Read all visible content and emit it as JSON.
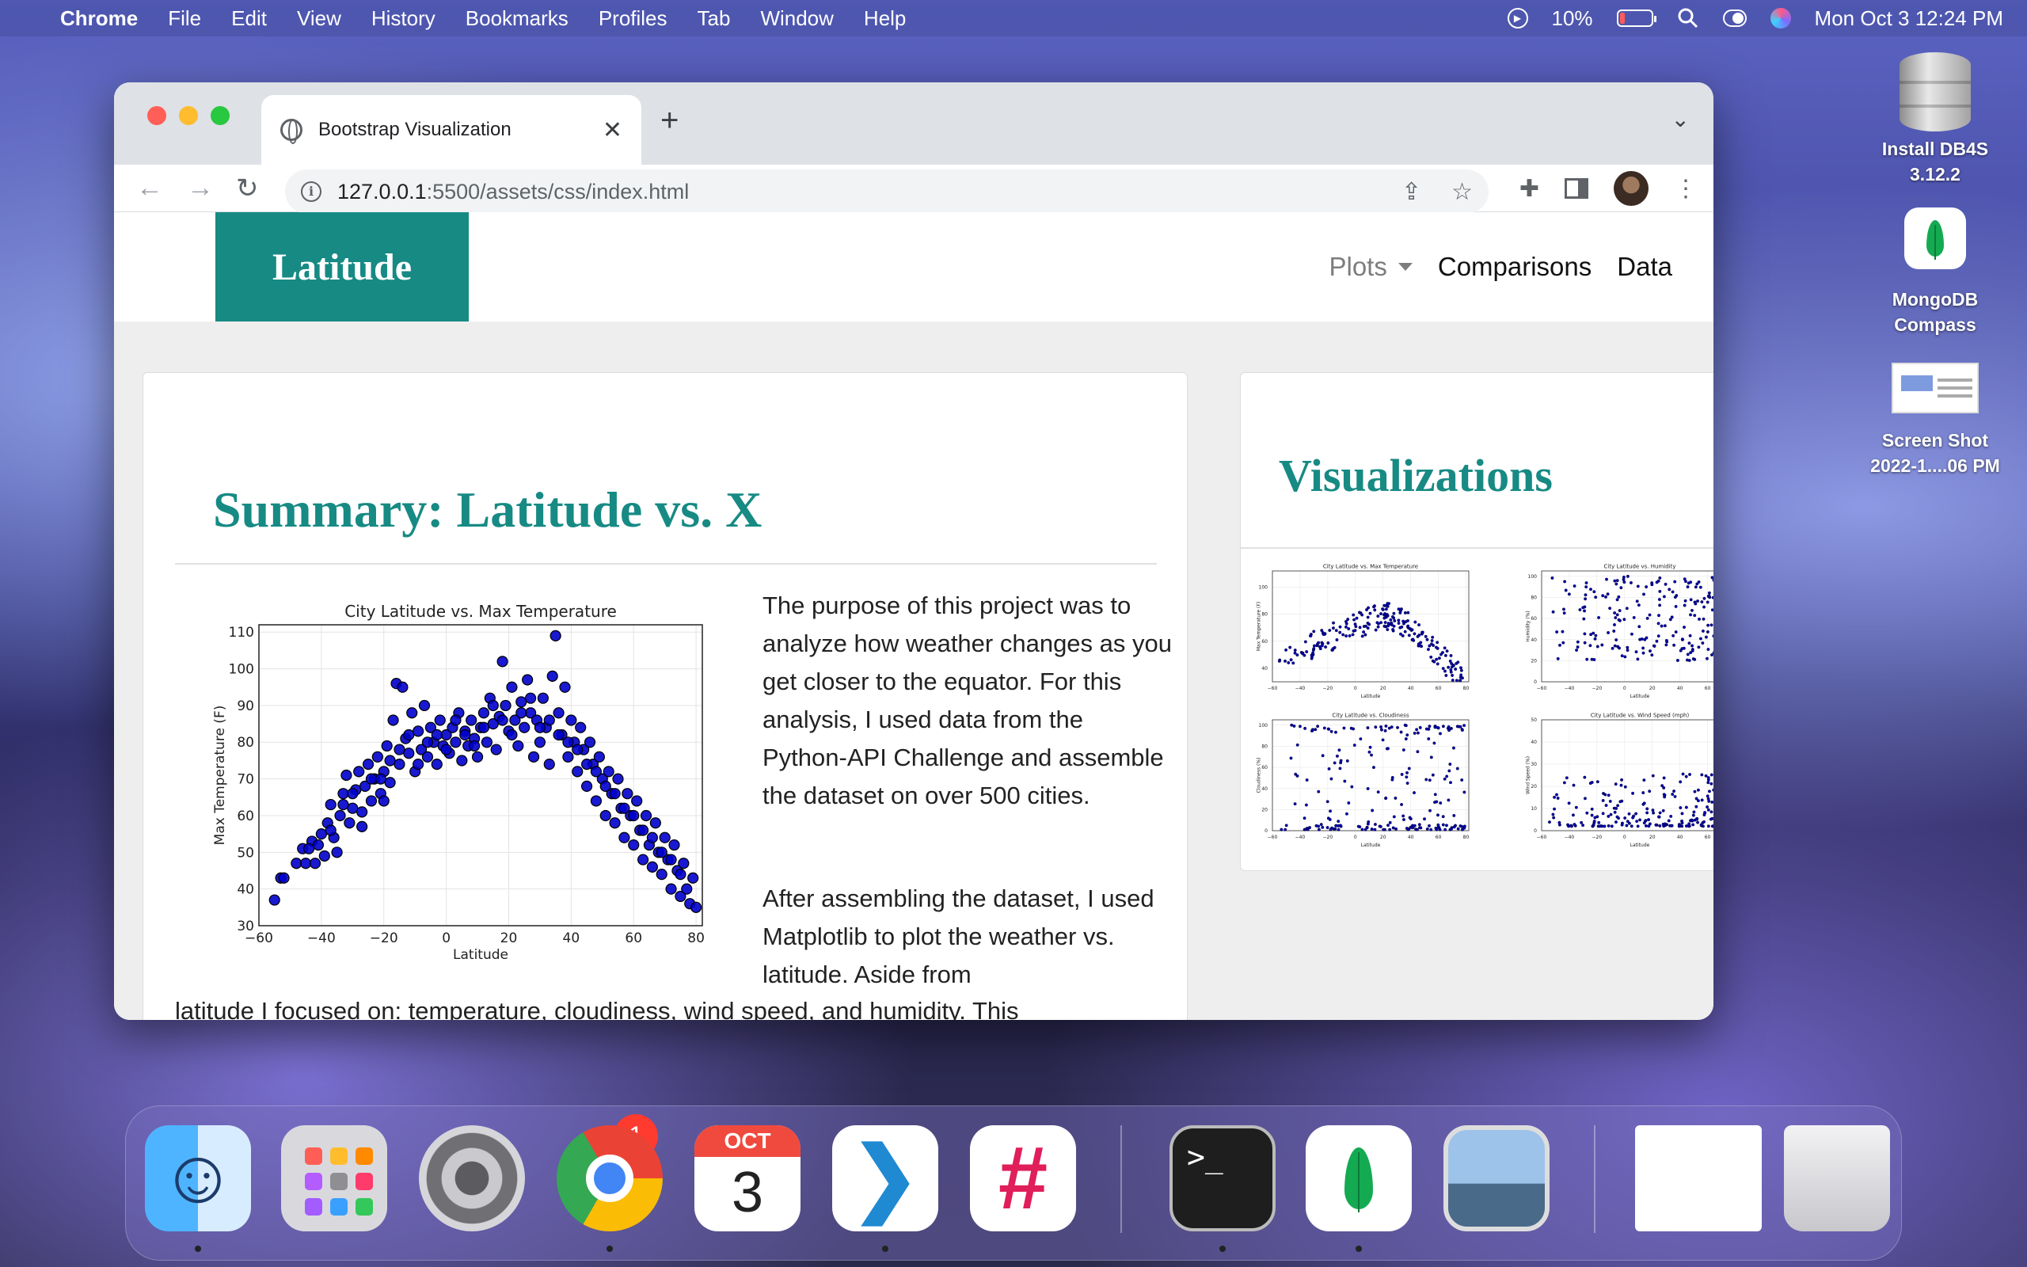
{
  "menubar": {
    "app_name": "Chrome",
    "menus": [
      "File",
      "Edit",
      "View",
      "History",
      "Bookmarks",
      "Profiles",
      "Tab",
      "Window",
      "Help"
    ],
    "battery": "10%",
    "datetime": "Mon Oct 3  12:24 PM"
  },
  "desktop": {
    "icons": [
      {
        "label_line1": "Install DB4S",
        "label_line2": "3.12.2",
        "icon": "database-icon"
      },
      {
        "label_line1": "MongoDB",
        "label_line2": "Compass",
        "icon": "mongodb-icon"
      },
      {
        "label_line1": "Screen Shot",
        "label_line2": "2022-1....06 PM",
        "icon": "screenshot-icon"
      }
    ]
  },
  "browser": {
    "tab_title": "Bootstrap Visualization",
    "url_host": "127.0.0.1",
    "url_rest": ":5500/assets/css/index.html"
  },
  "page": {
    "brand": "Latitude",
    "nav": {
      "plots": "Plots",
      "comparisons": "Comparisons",
      "data": "Data"
    },
    "summary_title": "Summary: Latitude vs. X",
    "paragraph1": "The purpose of this project was to analyze how weather changes as you get closer to the equator. For this analysis, I used data from the Python-API Challenge and assemble the dataset on over 500 cities.",
    "paragraph2": "After assembling the dataset, I used Matplotlib to plot the weather vs. latitude. Aside from",
    "paragraph2_tail": "latitude I focused on: temperature, cloudiness, wind speed, and humidity. This",
    "visualizations_title": "Visualizations"
  },
  "chart_data": [
    {
      "type": "scatter",
      "title": "City Latitude vs. Max Temperature",
      "xlabel": "Latitude",
      "ylabel": "Max Temperature (F)",
      "xlim": [
        -60,
        82
      ],
      "ylim": [
        30,
        112
      ],
      "xticks": [
        -60,
        -40,
        -20,
        0,
        20,
        40,
        60,
        80
      ],
      "yticks": [
        30,
        40,
        50,
        60,
        70,
        80,
        90,
        100,
        110
      ],
      "marker_color": "#0000cc",
      "points": [
        [
          -55,
          37
        ],
        [
          -53,
          43
        ],
        [
          -52,
          43
        ],
        [
          -48,
          47
        ],
        [
          -46,
          51
        ],
        [
          -45,
          47
        ],
        [
          -43,
          53
        ],
        [
          -42,
          47
        ],
        [
          -41,
          52
        ],
        [
          -40,
          55
        ],
        [
          -39,
          49
        ],
        [
          -38,
          58
        ],
        [
          -37,
          63
        ],
        [
          -36,
          54
        ],
        [
          -35,
          50
        ],
        [
          -34,
          60
        ],
        [
          -33,
          66
        ],
        [
          -32,
          71
        ],
        [
          -31,
          58
        ],
        [
          -30,
          62
        ],
        [
          -29,
          67
        ],
        [
          -28,
          72
        ],
        [
          -27,
          61
        ],
        [
          -26,
          68
        ],
        [
          -25,
          74
        ],
        [
          -24,
          64
        ],
        [
          -23,
          70
        ],
        [
          -22,
          76
        ],
        [
          -21,
          66
        ],
        [
          -20,
          72
        ],
        [
          -19,
          79
        ],
        [
          -18,
          69
        ],
        [
          -17,
          86
        ],
        [
          -16,
          96
        ],
        [
          -15,
          74
        ],
        [
          -14,
          95
        ],
        [
          -13,
          81
        ],
        [
          -12,
          77
        ],
        [
          -11,
          88
        ],
        [
          -10,
          72
        ],
        [
          -9,
          83
        ],
        [
          -8,
          78
        ],
        [
          -7,
          90
        ],
        [
          -6,
          76
        ],
        [
          -5,
          84
        ],
        [
          -4,
          80
        ],
        [
          -3,
          74
        ],
        [
          -2,
          86
        ],
        [
          -1,
          79
        ],
        [
          0,
          82
        ],
        [
          1,
          77
        ],
        [
          2,
          84
        ],
        [
          3,
          80
        ],
        [
          4,
          88
        ],
        [
          5,
          75
        ],
        [
          6,
          83
        ],
        [
          7,
          79
        ],
        [
          8,
          86
        ],
        [
          9,
          81
        ],
        [
          10,
          76
        ],
        [
          11,
          84
        ],
        [
          12,
          88
        ],
        [
          13,
          80
        ],
        [
          14,
          92
        ],
        [
          15,
          85
        ],
        [
          16,
          78
        ],
        [
          17,
          87
        ],
        [
          18,
          102
        ],
        [
          19,
          90
        ],
        [
          20,
          83
        ],
        [
          21,
          95
        ],
        [
          22,
          86
        ],
        [
          23,
          79
        ],
        [
          24,
          91
        ],
        [
          25,
          84
        ],
        [
          26,
          97
        ],
        [
          27,
          88
        ],
        [
          28,
          76
        ],
        [
          29,
          86
        ],
        [
          30,
          80
        ],
        [
          31,
          92
        ],
        [
          32,
          84
        ],
        [
          33,
          74
        ],
        [
          34,
          98
        ],
        [
          35,
          109
        ],
        [
          36,
          88
        ],
        [
          37,
          82
        ],
        [
          38,
          95
        ],
        [
          39,
          76
        ],
        [
          40,
          86
        ],
        [
          41,
          80
        ],
        [
          42,
          72
        ],
        [
          43,
          84
        ],
        [
          44,
          78
        ],
        [
          45,
          68
        ],
        [
          46,
          80
        ],
        [
          47,
          74
        ],
        [
          48,
          64
        ],
        [
          49,
          76
        ],
        [
          50,
          70
        ],
        [
          51,
          60
        ],
        [
          52,
          72
        ],
        [
          53,
          66
        ],
        [
          54,
          58
        ],
        [
          55,
          70
        ],
        [
          56,
          62
        ],
        [
          57,
          54
        ],
        [
          58,
          66
        ],
        [
          59,
          60
        ],
        [
          60,
          52
        ],
        [
          61,
          64
        ],
        [
          62,
          56
        ],
        [
          63,
          48
        ],
        [
          64,
          60
        ],
        [
          65,
          52
        ],
        [
          66,
          46
        ],
        [
          67,
          58
        ],
        [
          68,
          50
        ],
        [
          69,
          44
        ],
        [
          70,
          54
        ],
        [
          71,
          48
        ],
        [
          72,
          40
        ],
        [
          73,
          52
        ],
        [
          74,
          45
        ],
        [
          75,
          38
        ],
        [
          76,
          47
        ],
        [
          77,
          40
        ],
        [
          78,
          36
        ],
        [
          79,
          43
        ],
        [
          80,
          35
        ],
        [
          -44,
          51
        ],
        [
          -37,
          56
        ],
        [
          -30,
          66
        ],
        [
          -24,
          70
        ],
        [
          -18,
          75
        ],
        [
          -12,
          82
        ],
        [
          -6,
          80
        ],
        [
          0,
          78
        ],
        [
          6,
          82
        ],
        [
          12,
          84
        ],
        [
          18,
          86
        ],
        [
          24,
          88
        ],
        [
          30,
          84
        ],
        [
          36,
          82
        ],
        [
          42,
          78
        ],
        [
          48,
          72
        ],
        [
          54,
          66
        ],
        [
          60,
          60
        ],
        [
          66,
          54
        ],
        [
          72,
          48
        ],
        [
          -27,
          57
        ],
        [
          -21,
          70
        ],
        [
          -15,
          78
        ],
        [
          -9,
          74
        ],
        [
          -3,
          82
        ],
        [
          3,
          86
        ],
        [
          9,
          79
        ],
        [
          15,
          90
        ],
        [
          21,
          82
        ],
        [
          27,
          92
        ],
        [
          33,
          86
        ],
        [
          39,
          80
        ],
        [
          45,
          74
        ],
        [
          51,
          68
        ],
        [
          57,
          62
        ],
        [
          63,
          56
        ],
        [
          69,
          50
        ],
        [
          75,
          44
        ],
        [
          -33,
          63
        ],
        [
          -20,
          64
        ]
      ]
    },
    {
      "type": "scatter",
      "title": "City Latitude vs. Max Temperature",
      "xlabel": "Latitude",
      "ylabel": "Max Temperature (F)",
      "xlim": [
        -60,
        82
      ],
      "ylim": [
        30,
        112
      ],
      "xticks": [
        -60,
        -40,
        -20,
        0,
        20,
        40,
        60,
        80
      ]
    },
    {
      "type": "scatter",
      "title": "City Latitude vs. Humidity",
      "xlabel": "Latitude",
      "ylabel": "Humidity (%)",
      "xlim": [
        -60,
        82
      ],
      "ylim": [
        0,
        105
      ],
      "xticks": [
        -60,
        -40,
        -20,
        0,
        20,
        40,
        60,
        80
      ]
    },
    {
      "type": "scatter",
      "title": "City Latitude vs. Cloudiness",
      "xlabel": "Latitude",
      "ylabel": "Cloudiness (%)",
      "xlim": [
        -60,
        82
      ],
      "ylim": [
        0,
        105
      ],
      "xticks": [
        -60,
        -40,
        -20,
        0,
        20,
        40,
        60,
        80
      ]
    },
    {
      "type": "scatter",
      "title": "City Latitude vs. Wind Speed (mph)",
      "xlabel": "Latitude",
      "ylabel": "Wind Speed (%)",
      "xlim": [
        -60,
        82
      ],
      "ylim": [
        0,
        50
      ],
      "xticks": [
        -60,
        -40,
        -20,
        0,
        20,
        40,
        60,
        80
      ]
    }
  ],
  "dock": {
    "calendar_month": "OCT",
    "calendar_day": "3",
    "settings_badge": "1"
  }
}
